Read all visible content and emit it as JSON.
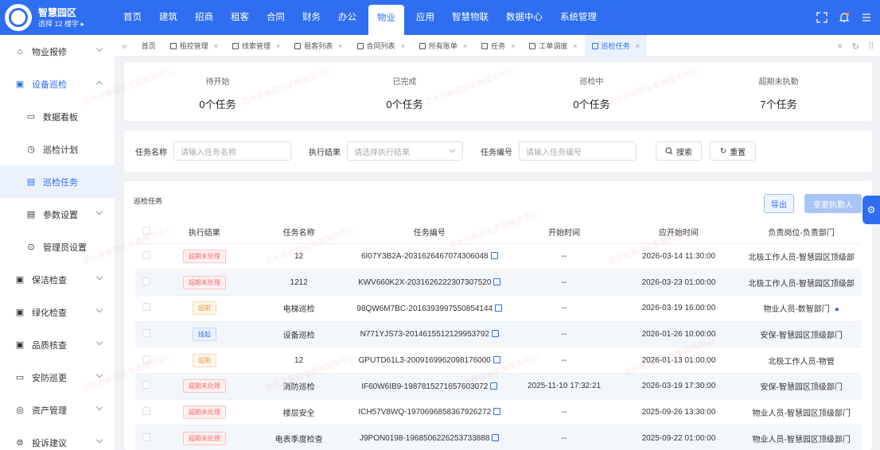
{
  "app": {
    "title": "智慧园区",
    "subtitle": "选择 12 楼宇 ▸"
  },
  "nav": [
    "首页",
    "建筑",
    "招商",
    "租客",
    "合同",
    "财务",
    "办公",
    "物业",
    "应用",
    "智慧物联",
    "数据中心",
    "系统管理"
  ],
  "nav_active_index": 7,
  "sidebar": [
    {
      "label": "物业报修",
      "arrow": "down",
      "level": 0
    },
    {
      "label": "设备巡检",
      "arrow": "up",
      "level": 0,
      "open": true
    },
    {
      "label": "数据看板",
      "level": 1
    },
    {
      "label": "巡检计划",
      "level": 1
    },
    {
      "label": "巡检任务",
      "level": 1,
      "active": true
    },
    {
      "label": "参数设置",
      "arrow": "down",
      "level": 1
    },
    {
      "label": "管理员设置",
      "level": 1
    },
    {
      "label": "保洁检查",
      "arrow": "down",
      "level": 0
    },
    {
      "label": "绿化检查",
      "arrow": "down",
      "level": 0
    },
    {
      "label": "品质核查",
      "arrow": "down",
      "level": 0
    },
    {
      "label": "安防巡更",
      "arrow": "down",
      "level": 0
    },
    {
      "label": "资产管理",
      "arrow": "down",
      "level": 0
    },
    {
      "label": "投诉建议",
      "arrow": "down",
      "level": 0
    }
  ],
  "tabs": [
    {
      "label": "首页",
      "close": false
    },
    {
      "label": "租控管理",
      "close": true
    },
    {
      "label": "线索管理",
      "close": true
    },
    {
      "label": "租客列表",
      "close": true
    },
    {
      "label": "合同列表",
      "close": true
    },
    {
      "label": "所有账单",
      "close": true
    },
    {
      "label": "任务",
      "close": true
    },
    {
      "label": "工单调度",
      "close": true
    },
    {
      "label": "巡检任务",
      "close": true,
      "active": true
    }
  ],
  "stats": [
    {
      "label": "待开始",
      "value": "0个任务"
    },
    {
      "label": "已完成",
      "value": "0个任务"
    },
    {
      "label": "巡检中",
      "value": "0个任务"
    },
    {
      "label": "超期未执勤",
      "value": "7个任务"
    }
  ],
  "filters": {
    "name_label": "任务名称",
    "name_placeholder": "请输入任务名称",
    "result_label": "执行结果",
    "result_placeholder": "请选择执行结果",
    "code_label": "任务编号",
    "code_placeholder": "请输入任务编号",
    "search_label": "搜索",
    "reset_label": "重置"
  },
  "table": {
    "title": "巡检任务",
    "export_label": "导出",
    "change_label": "变更执勤人",
    "headers": [
      "执行结果",
      "任务名称",
      "任务编号",
      "开始时间",
      "应开始时间",
      "负责岗位-负责部门"
    ],
    "rows": [
      {
        "status": "超期未处理",
        "status_color": "red",
        "name": "12",
        "code": "6I07Y3B2A-2031626467074306048",
        "start": "--",
        "due": "2026-03-14 11:30:00",
        "dept": "北极工作人员-智慧园区顶级部"
      },
      {
        "status": "超期未处理",
        "status_color": "red",
        "name": "1212",
        "code": "KWV660K2X-2031626222307307520",
        "start": "--",
        "due": "2026-03-23 01:00:00",
        "dept": "北极工作人员-智慧园区顶级部"
      },
      {
        "status": "超期",
        "status_color": "orange",
        "name": "电梯巡检",
        "code": "98QW6M7BC-2016393997550854144",
        "start": "--",
        "due": "2026-03-19 16:00:00",
        "dept": "物业人员-数智部门",
        "user_icon": true
      },
      {
        "status": "挂起",
        "status_color": "blue",
        "name": "设备巡检",
        "code": "N771YJS73-2014615512129953792",
        "start": "--",
        "due": "2026-01-26 10:00:00",
        "dept": "安保-智慧园区顶级部门"
      },
      {
        "status": "超期",
        "status_color": "orange",
        "name": "12",
        "code": "GPUTD61L3-2009169962098176000",
        "start": "--",
        "due": "2026-01-13 01:00:00",
        "dept": "北极工作人员-物管"
      },
      {
        "status": "超期未处理",
        "status_color": "red",
        "name": "消防巡检",
        "code": "IF60W6IB9-1987815271657603072",
        "start": "2025-11-10 17:32:21",
        "due": "2026-03-19 17:30:00",
        "dept": "安保-智慧园区顶级部门"
      },
      {
        "status": "超期未处理",
        "status_color": "red",
        "name": "楼层安全",
        "code": "ICH57V8WQ-1970696858367926272",
        "start": "--",
        "due": "2025-09-26 13:30:00",
        "dept": "物业人员-智慧园区顶级部门"
      },
      {
        "status": "超期未处理",
        "status_color": "red",
        "name": "电表季度检查",
        "code": "J9PON0198-1968506226253733888",
        "start": "--",
        "due": "2025-09-22 01:00:00",
        "dept": "物业人员-智慧园区顶级部门"
      }
    ]
  },
  "colors": {
    "primary": "#2f6ef0",
    "danger": "#f56c6c",
    "warning": "#e6a23c"
  }
}
